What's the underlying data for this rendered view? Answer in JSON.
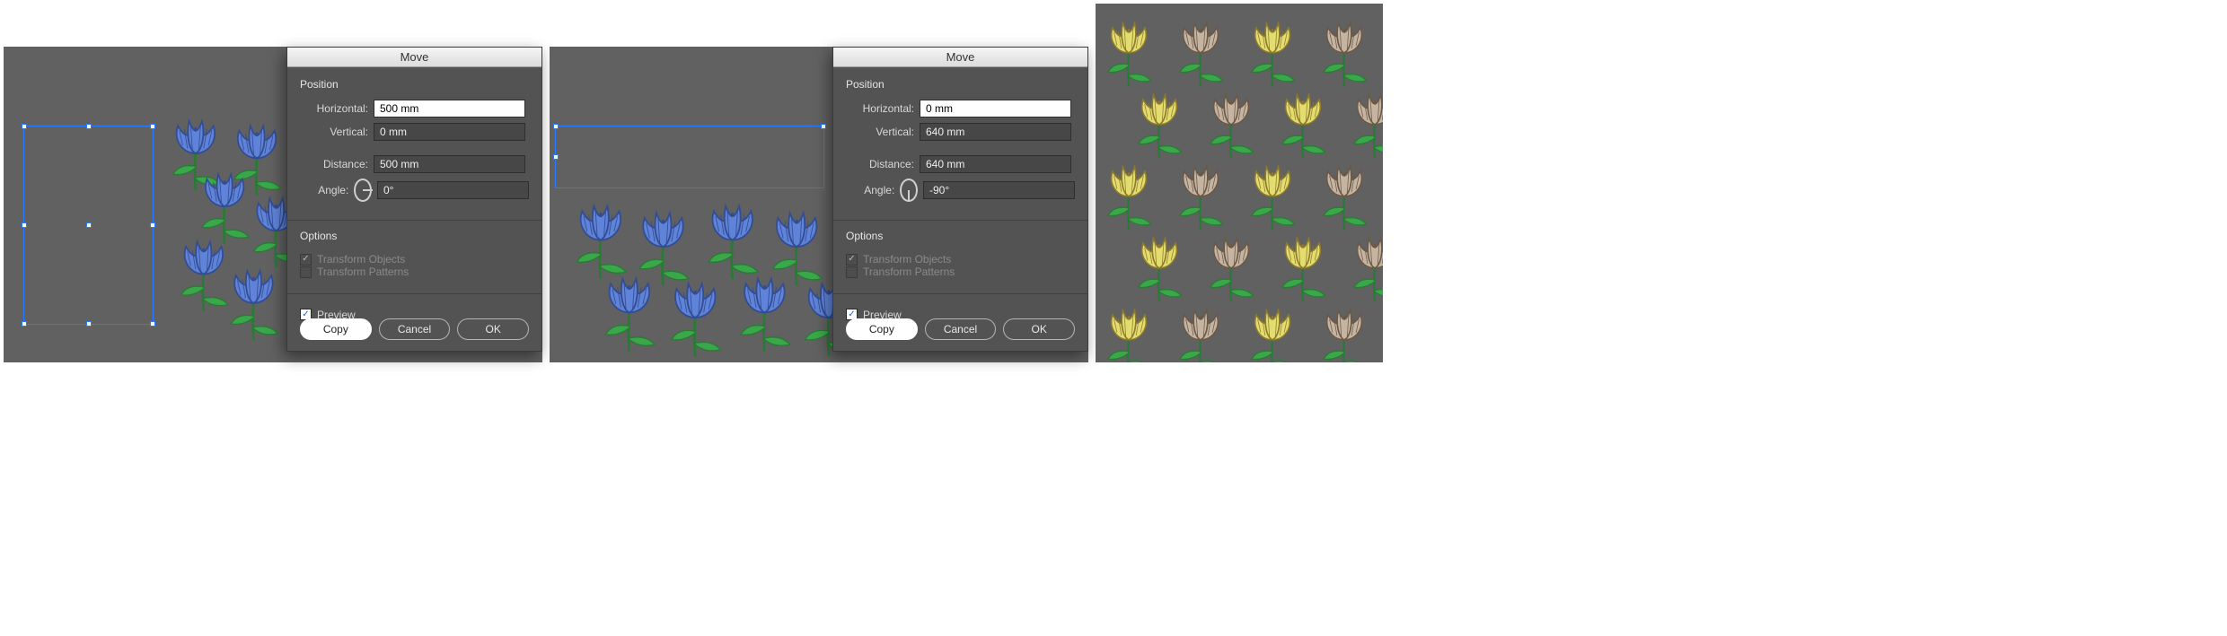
{
  "dialog1": {
    "title": "Move",
    "position_label": "Position",
    "horizontal_label": "Horizontal:",
    "horizontal_value": "500 mm",
    "vertical_label": "Vertical:",
    "vertical_value": "0 mm",
    "distance_label": "Distance:",
    "distance_value": "500 mm",
    "angle_label": "Angle:",
    "angle_value": "0°",
    "angle_deg": 0,
    "options_label": "Options",
    "transform_objects_label": "Transform Objects",
    "transform_patterns_label": "Transform Patterns",
    "preview_label": "Preview",
    "copy_label": "Copy",
    "cancel_label": "Cancel",
    "ok_label": "OK"
  },
  "dialog2": {
    "title": "Move",
    "position_label": "Position",
    "horizontal_label": "Horizontal:",
    "horizontal_value": "0 mm",
    "vertical_label": "Vertical:",
    "vertical_value": "640 mm",
    "distance_label": "Distance:",
    "distance_value": "640 mm",
    "angle_label": "Angle:",
    "angle_value": "-90°",
    "angle_deg": -90,
    "options_label": "Options",
    "transform_objects_label": "Transform Objects",
    "transform_patterns_label": "Transform Patterns",
    "preview_label": "Preview",
    "copy_label": "Copy",
    "cancel_label": "Cancel",
    "ok_label": "OK"
  },
  "colors": {
    "blue_petal": "#5f83d8",
    "blue_stroke": "#334d94",
    "yellow_petal": "#e2dd6e",
    "yellow_stroke": "#8d7a2d",
    "brown_petal": "#c5b4a1",
    "brown_stroke": "#6b5946",
    "leaf": "#3aa84a",
    "leaf_stroke": "#2a7a35"
  }
}
